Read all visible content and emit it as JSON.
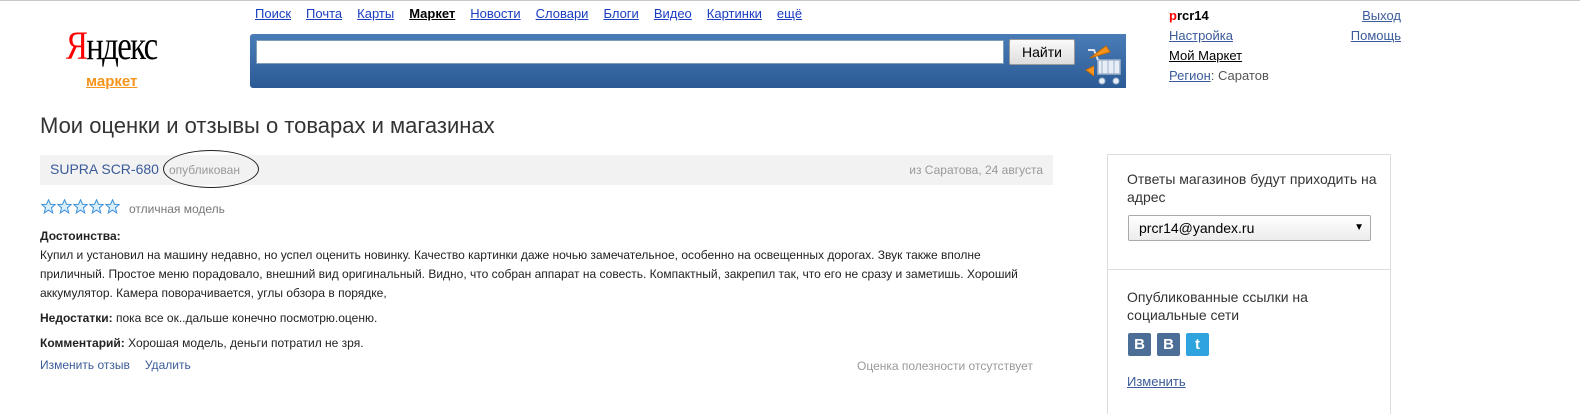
{
  "logo": {
    "first_letter": "Я",
    "rest": "ндекс",
    "sub": "маркет"
  },
  "nav": [
    {
      "label": "Поиск",
      "active": false
    },
    {
      "label": "Почта",
      "active": false
    },
    {
      "label": "Карты",
      "active": false
    },
    {
      "label": "Маркет",
      "active": true
    },
    {
      "label": "Новости",
      "active": false
    },
    {
      "label": "Словари",
      "active": false
    },
    {
      "label": "Блоги",
      "active": false
    },
    {
      "label": "Видео",
      "active": false
    },
    {
      "label": "Картинки",
      "active": false
    },
    {
      "label": "ещё",
      "active": false
    }
  ],
  "search": {
    "value": "",
    "placeholder": "",
    "button_label": "Найти",
    "icon": "cart-icon"
  },
  "user": {
    "login_first": "p",
    "login_rest": "rcr14",
    "settings": "Настройка",
    "my_market": "Мой Маркет",
    "region_label": "Регион",
    "region_sep": ": ",
    "region_value": "Саратов",
    "logout": "Выход",
    "help": "Помощь"
  },
  "page_title": "Мои оценки и отзывы о товарах и магазинах",
  "review": {
    "product": "SUPRA SCR-680",
    "status": "опубликован",
    "meta": "из Саратова, 24 августа",
    "rating": 5,
    "rating_max": 5,
    "rating_text": "отличная модель",
    "pros_label": "Достоинства:",
    "pros_text": "Купил и установил на машину недавно, но успел оценить новинку. Качество картинки даже ночью замечательное, особенно на освещенных дорогах. Звук также вполне приличный. Простое меню порадовало, внешний вид оригинальный. Видно, что собран аппарат на совесть. Компактный, закрепил так, что его не сразу и заметишь. Хороший аккумулятор. Камера поворачивается, углы обзора в порядке,",
    "cons_label": "Недостатки:",
    "cons_text": "пока все ок..дальше конечно посмотрю.оценю.",
    "comment_label": "Комментарий:",
    "comment_text": "Хорошая модель, деньги потратил не зря.",
    "edit_label": "Изменить отзыв",
    "delete_label": "Удалить",
    "usefulness": "Оценка полезности отсутствует"
  },
  "side": {
    "answers_text": "Ответы магазинов будут приходить на адрес",
    "email_selected": "prcr14@yandex.ru",
    "social_title": "Опубликованные ссылки на социальные сети",
    "social": [
      {
        "icon": "vk-icon",
        "glyph": "В"
      },
      {
        "icon": "vk-icon",
        "glyph": "В"
      },
      {
        "icon": "twitter-icon",
        "glyph": "t"
      }
    ],
    "change_label": "Изменить"
  },
  "colors": {
    "accent_red": "#ff0000",
    "market_orange": "#f7941d",
    "search_blue": "#2b5a94",
    "link_blue": "#3b5b99"
  }
}
